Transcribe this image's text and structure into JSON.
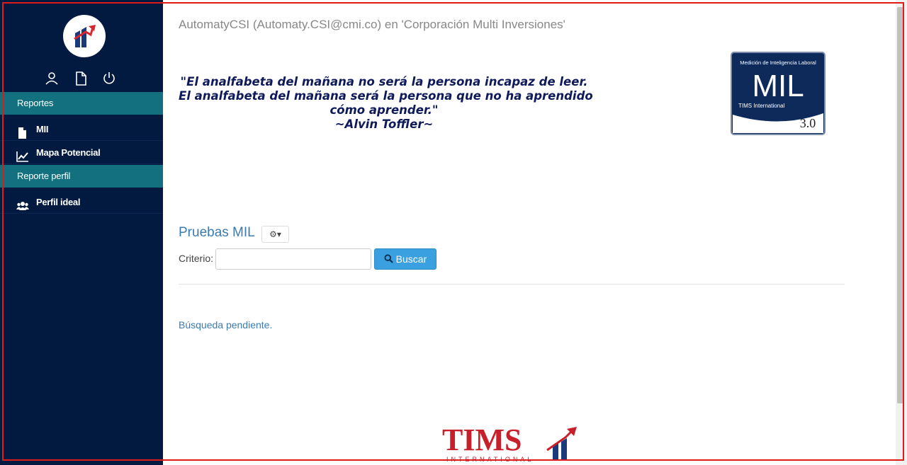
{
  "sidebar": {
    "sections": [
      {
        "label": "Reportes",
        "items": [
          {
            "label": "MII",
            "icon": "file-icon"
          },
          {
            "label": "Mapa Potencial",
            "icon": "line-chart-icon"
          }
        ]
      },
      {
        "label": "Reporte perfil",
        "items": [
          {
            "label": "Perfil ideal",
            "icon": "users-icon"
          }
        ]
      }
    ],
    "top_icons": [
      "user-icon",
      "document-icon",
      "power-icon"
    ]
  },
  "header": {
    "title": "AutomatyCSI (Automaty.CSI@cmi.co) en 'Corporación Multi Inversiones'"
  },
  "quote": {
    "lines": [
      "\"El analfabeta del mañana no será la persona incapaz de leer.",
      "El analfabeta del mañana será la persona que no ha aprendido",
      "cómo aprender.\"",
      "~Alvin Toffler~"
    ]
  },
  "mil_badge": {
    "top_text": "Medición de Inteligencia Laboral",
    "big": "MIL",
    "sub": "TIMS International",
    "version": "3.0"
  },
  "pruebas": {
    "title": "Pruebas MIL",
    "gear_caret": "⚙▾",
    "criterio_label": "Criterio:",
    "criterio_value": "",
    "buscar_label": "Buscar",
    "pending": "Búsqueda pendiente."
  },
  "footer": {
    "brand": "TIMS",
    "brand_sub": "INTERNATIONAL"
  },
  "colors": {
    "sidebar": "#031a40",
    "section": "#13707e",
    "accent": "#3aa0df",
    "link": "#3b7bb0"
  }
}
